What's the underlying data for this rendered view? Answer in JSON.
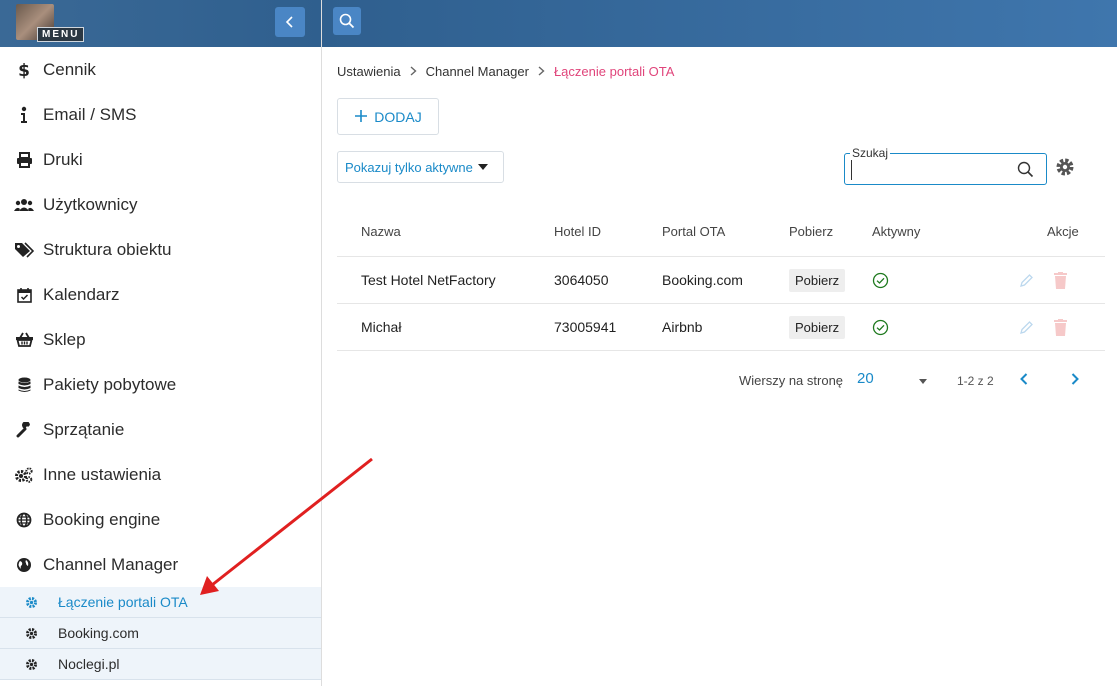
{
  "sidebar": {
    "menu_label": "MENU",
    "items": [
      {
        "label": "Cennik",
        "icon": "dollar-icon"
      },
      {
        "label": "Email / SMS",
        "icon": "info-icon"
      },
      {
        "label": "Druki",
        "icon": "printer-icon"
      },
      {
        "label": "Użytkownicy",
        "icon": "users-icon"
      },
      {
        "label": "Struktura obiektu",
        "icon": "tags-icon"
      },
      {
        "label": "Kalendarz",
        "icon": "calendar-check-icon"
      },
      {
        "label": "Sklep",
        "icon": "basket-icon"
      },
      {
        "label": "Pakiety pobytowe",
        "icon": "database-icon"
      },
      {
        "label": "Sprzątanie",
        "icon": "wrench-icon"
      },
      {
        "label": "Inne ustawienia",
        "icon": "cogs-icon"
      },
      {
        "label": "Booking engine",
        "icon": "globe-icon"
      },
      {
        "label": "Channel Manager",
        "icon": "globe-americas-icon"
      }
    ],
    "subitems": [
      {
        "label": "Łączenie portali OTA",
        "active": true
      },
      {
        "label": "Booking.com",
        "active": false
      },
      {
        "label": "Noclegi.pl",
        "active": false
      }
    ]
  },
  "breadcrumb": {
    "items": [
      "Ustawienia",
      "Channel Manager"
    ],
    "current": "Łączenie portali OTA"
  },
  "toolbar": {
    "add_label": "DODAJ",
    "filter_label": "Pokazuj tylko aktywne",
    "search_legend": "Szukaj",
    "search_value": ""
  },
  "table": {
    "headers": {
      "name": "Nazwa",
      "hotel_id": "Hotel ID",
      "portal": "Portal OTA",
      "download": "Pobierz",
      "active": "Aktywny",
      "actions": "Akcje"
    },
    "rows": [
      {
        "name": "Test Hotel NetFactory",
        "hotel_id": "3064050",
        "portal": "Booking.com",
        "download": "Pobierz",
        "active": true
      },
      {
        "name": "Michał",
        "hotel_id": "73005941",
        "portal": "Airbnb",
        "download": "Pobierz",
        "active": true
      }
    ]
  },
  "pager": {
    "rows_label": "Wierszy na stronę",
    "rows_value": "20",
    "range": "1-2 z 2"
  },
  "colors": {
    "header": "#3a6996",
    "accent": "#1a8ac8",
    "breadcrumb_current": "#e0457b",
    "annotation_arrow": "#e02020"
  }
}
